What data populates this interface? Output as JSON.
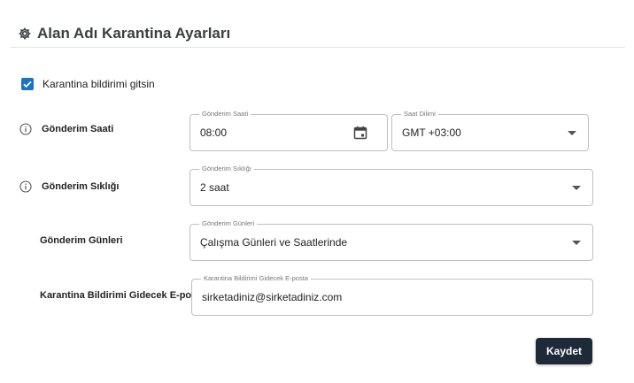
{
  "header": {
    "title": "Alan Adı Karantina Ayarları",
    "icon": "settings-gear-icon"
  },
  "quarantine_notify": {
    "label": "Karantina bildirimi gitsin",
    "checked": true
  },
  "send_time": {
    "label": "Gönderim Saati",
    "time_field": {
      "legend": "Gönderim Saati",
      "value": "08:00"
    },
    "timezone_field": {
      "legend": "Saat Dilimi",
      "value": "GMT +03:00"
    }
  },
  "frequency": {
    "label": "Gönderim Sıklığı",
    "field": {
      "legend": "Gönderim Sıklığı",
      "value": "2 saat"
    }
  },
  "send_days": {
    "label": "Gönderim Günleri",
    "field": {
      "legend": "Gönderim Günleri",
      "value": "Çalışma Günleri ve Saatlerinde"
    }
  },
  "email": {
    "label": "Karantina Bildirimi Gidecek E-posta",
    "field": {
      "legend": "Karantina Bildirimi Gidecek E-posta",
      "value": "sirketadiniz@sirketadiniz.com"
    }
  },
  "actions": {
    "save_label": "Kaydet"
  },
  "colors": {
    "accent": "#1a73c8",
    "button": "#1f2a38"
  }
}
